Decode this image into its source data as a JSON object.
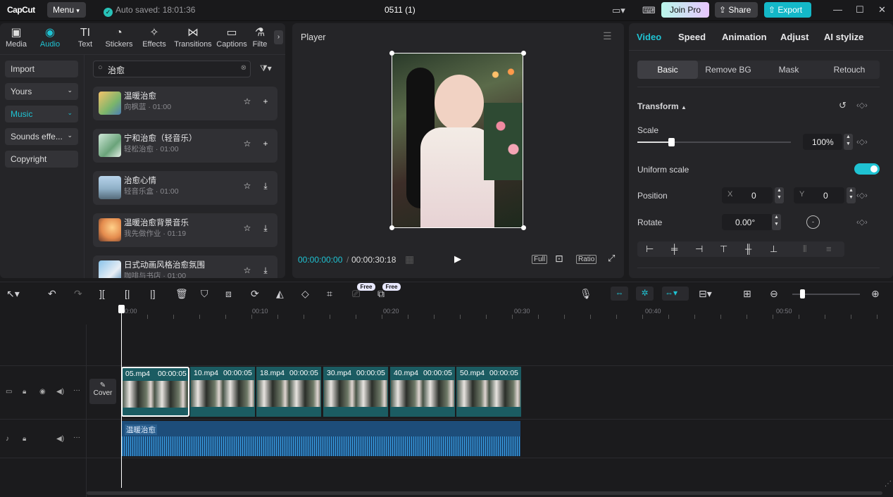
{
  "app": {
    "logo": "CapCut",
    "menu_label": "Menu",
    "autosave": "Auto saved: 18:01:36",
    "title": "0511 (1)"
  },
  "topbar": {
    "join_pro": "Join Pro",
    "share": "Share",
    "export": "Export"
  },
  "tool_tabs": [
    {
      "label": "Media",
      "icon": "▣"
    },
    {
      "label": "Audio",
      "icon": "◉"
    },
    {
      "label": "Text",
      "icon": "TI"
    },
    {
      "label": "Stickers",
      "icon": "◔"
    },
    {
      "label": "Effects",
      "icon": "✧"
    },
    {
      "label": "Transitions",
      "icon": "⋈"
    },
    {
      "label": "Captions",
      "icon": "▭"
    },
    {
      "label": "Filte",
      "icon": "⚗"
    }
  ],
  "left_nav": [
    {
      "label": "Import"
    },
    {
      "label": "Yours"
    },
    {
      "label": "Music"
    },
    {
      "label": "Sounds effe..."
    },
    {
      "label": "Copyright"
    }
  ],
  "search": {
    "value": "治愈"
  },
  "audio_items": [
    {
      "title": "温暖治愈",
      "sub": "向枫蓝 · 01:00",
      "action": "+"
    },
    {
      "title": "宁和治愈（轻音乐）",
      "sub": "轻松治愈 · 01:00",
      "action": "+"
    },
    {
      "title": "治愈心情",
      "sub": "轻音乐盒 · 01:00",
      "action": "⤓"
    },
    {
      "title": "温暖治愈背景音乐",
      "sub": "我先做作业 · 01:19",
      "action": "⤓"
    },
    {
      "title": "日式动画风格治愈氛围",
      "sub": "咖啡与书店 · 01:00",
      "action": "⤓"
    }
  ],
  "player": {
    "title": "Player",
    "current_time": "00:00:00:00",
    "total_time": "00:00:30:18",
    "full": "Full",
    "ratio": "Ratio"
  },
  "right_tabs": [
    "Video",
    "Speed",
    "Animation",
    "Adjust",
    "AI stylize"
  ],
  "sub_tabs": [
    "Basic",
    "Remove BG",
    "Mask",
    "Retouch"
  ],
  "properties": {
    "transform": "Transform",
    "scale_label": "Scale",
    "scale_value": "100%",
    "scale_level": 0.22,
    "uniform_scale": "Uniform scale",
    "uniform_scale_on": true,
    "position": "Position",
    "x_label": "X",
    "x_value": "0",
    "y_label": "Y",
    "y_value": "0",
    "rotate": "Rotate",
    "rotate_value": "0.00°"
  },
  "toolbar": {
    "free1": "Free",
    "free2": "Free"
  },
  "ruler": [
    "00:00",
    "00:10",
    "00:20",
    "00:30",
    "00:40",
    "00:50"
  ],
  "cover_label": "Cover",
  "clips": [
    {
      "name": "05.mp4",
      "time": "00:00:05"
    },
    {
      "name": "10.mp4",
      "time": "00:00:05"
    },
    {
      "name": "18.mp4",
      "time": "00:00:05"
    },
    {
      "name": "30.mp4",
      "time": "00:00:05"
    },
    {
      "name": "40.mp4",
      "time": "00:00:05"
    },
    {
      "name": "50.mp4",
      "time": "00:00:05"
    }
  ],
  "audio_clip": {
    "name": "温暖治愈"
  },
  "colors": {
    "accent": "#1fc3d3",
    "export": "#14b8c8",
    "clip": "#1b5c62",
    "audio": "#1d4d7a"
  }
}
